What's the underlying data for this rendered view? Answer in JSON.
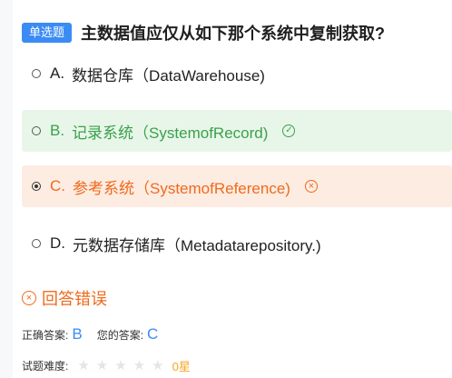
{
  "question": {
    "tag": "单选题",
    "title": "主数据值应仅从如下那个系统中复制获取?"
  },
  "options": [
    {
      "letter": "A.",
      "text": "数据仓库（DataWarehouse)"
    },
    {
      "letter": "B.",
      "text": "记录系统（SystemofRecord)",
      "status": "correct",
      "icon": "check-circle-icon"
    },
    {
      "letter": "C.",
      "text": "参考系统（SystemofReference)",
      "status": "wrong-selected",
      "icon": "x-circle-icon"
    },
    {
      "letter": "D.",
      "text": "元数据存储库（Metadatarepository.)"
    }
  ],
  "result": {
    "icon": "x-circle-icon",
    "text": "回答错误"
  },
  "answers": {
    "correct_label": "正确答案:",
    "correct_value": "B",
    "mine_label": "您的答案:",
    "mine_value": "C"
  },
  "difficulty": {
    "label": "试题难度:",
    "stars_total": 5,
    "stars_filled": 0,
    "stars_text": "0星"
  },
  "colors": {
    "accent": "#3b8bf5",
    "correct": "#3aa14a",
    "wrong": "#ef6a1c",
    "star_empty": "#e5e5e5",
    "star_text": "#f5a623"
  }
}
